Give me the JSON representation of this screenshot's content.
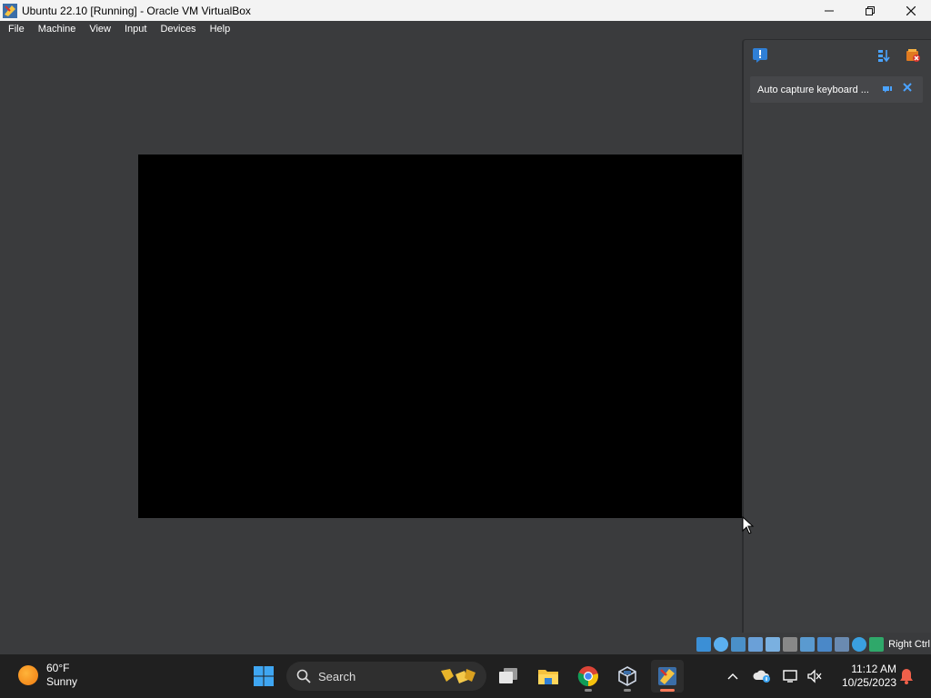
{
  "window": {
    "title": "Ubuntu 22.10 [Running] - Oracle VM VirtualBox"
  },
  "menu": {
    "items": [
      "File",
      "Machine",
      "View",
      "Input",
      "Devices",
      "Help"
    ]
  },
  "notification": {
    "text": "Auto capture keyboard ..."
  },
  "statusbar": {
    "host_key": "Right Ctrl"
  },
  "taskbar": {
    "weather_temp": "60°F",
    "weather_desc": "Sunny",
    "search_label": "Search",
    "time": "11:12 AM",
    "date": "10/25/2023"
  },
  "colors": {
    "accent": "#4aa3ff",
    "taskbar": "#202020",
    "vm_background": "#3a3b3d"
  },
  "icons": [
    "virtualbox-icon",
    "minimize-icon",
    "restore-icon",
    "close-icon",
    "notification-icon",
    "sort-icon",
    "clear-all-icon",
    "pin-icon",
    "windows-start-icon",
    "search-icon",
    "task-view-icon",
    "file-explorer-icon",
    "chrome-icon",
    "virtualbox-manager-icon",
    "chevron-up-icon",
    "network-icon",
    "display-icon",
    "volume-muted-icon",
    "bell-icon"
  ]
}
